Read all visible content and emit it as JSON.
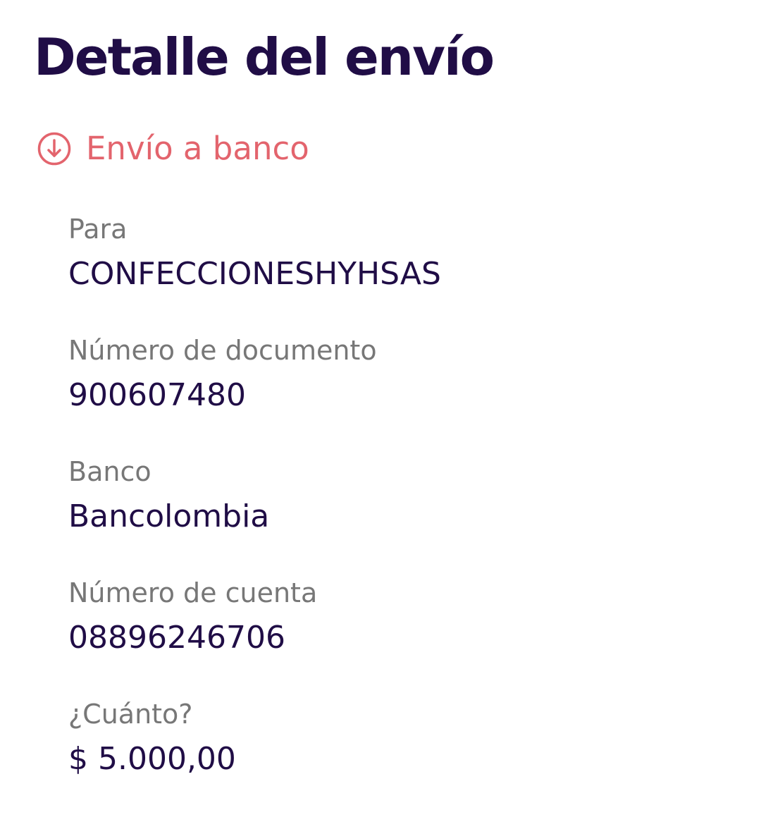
{
  "page_title": "Detalle del envío",
  "transfer_type": {
    "icon": "arrow-down-circle-icon",
    "label": "Envío a banco",
    "color": "#e3646d"
  },
  "details": [
    {
      "label": "Para",
      "value": "CONFECCIONESHYHSAS"
    },
    {
      "label": "Número de documento",
      "value": "900607480"
    },
    {
      "label": "Banco",
      "value": "Bancolombia"
    },
    {
      "label": "Número de cuenta",
      "value": "08896246706"
    },
    {
      "label": "¿Cuánto?",
      "value": "$ 5.000,00"
    }
  ],
  "colors": {
    "title": "#200d46",
    "label": "#777777",
    "value": "#200d46",
    "background": "#ffffff"
  }
}
